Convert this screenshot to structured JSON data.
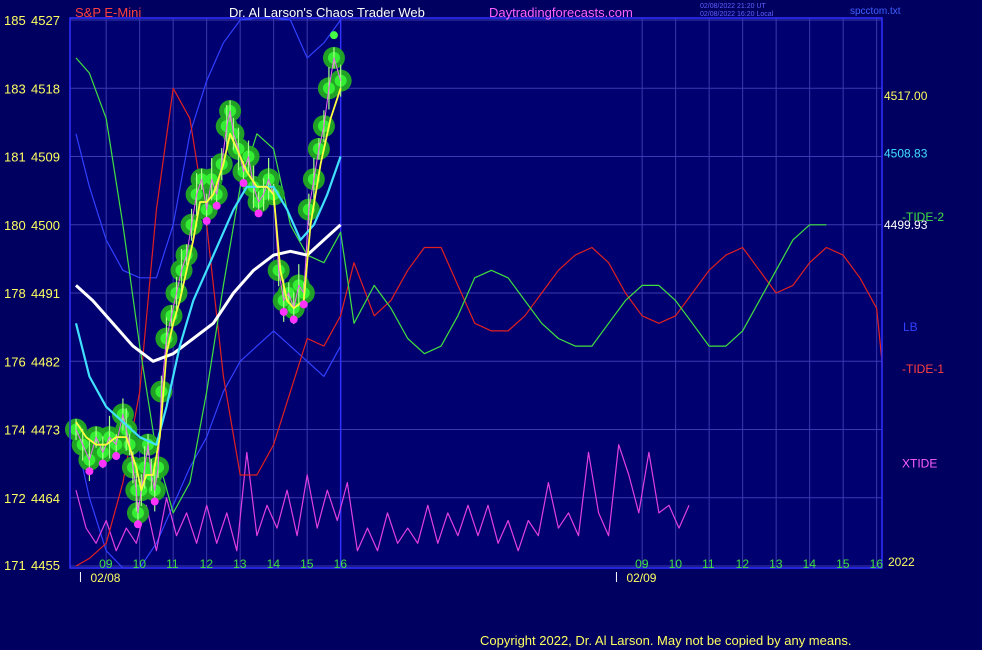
{
  "header": {
    "symbol": "S&P E-Mini",
    "title": "Dr. Al Larson's Chaos Trader Web",
    "site": "Daytradingforecasts.com",
    "stamp_line1": "02/08/2022 21:20 UT",
    "stamp_line2": "02/08/2022 16:20 Local",
    "file": "spcctom.txt"
  },
  "footer": {
    "year": "2022",
    "copyright": "Copyright 2022, Dr. Al Larson. May not be copied by any means."
  },
  "colors": {
    "background": "#000060",
    "plot_bg": "#000070",
    "grid": "#3a3ab0",
    "frame": "#3030ff",
    "price_green": "#22dd22",
    "tide1": "#e02020",
    "tide2": "#40e040",
    "xtide": "#e040e0",
    "lb": "#3040ff",
    "ma_yellow": "#ffff40",
    "ma_cyan": "#40e0ff",
    "ma_white": "#ffffff",
    "label_yellow": "#ffff60",
    "label_cyan": "#40e0ff",
    "label_red": "#ff4040",
    "label_magenta": "#ff60ff"
  },
  "chart_data": {
    "type": "line",
    "x_unit": "session hour (02/08 09:00 = 9, 02/09 09:00 = 25)",
    "xlim": [
      8.1,
      32.1
    ],
    "ylim": [
      4455,
      4527
    ],
    "y_ticks": [
      {
        "left": "185",
        "value": "4527"
      },
      {
        "left": "183",
        "value": "4518"
      },
      {
        "left": "181",
        "value": "4509"
      },
      {
        "left": "180",
        "value": "4500"
      },
      {
        "left": "178",
        "value": "4491"
      },
      {
        "left": "176",
        "value": "4482"
      },
      {
        "left": "174",
        "value": "4473"
      },
      {
        "left": "172",
        "value": "4464"
      },
      {
        "left": "171",
        "value": "4455"
      }
    ],
    "x_ticks": [
      {
        "x": 9,
        "label": "09"
      },
      {
        "x": 10,
        "label": "10"
      },
      {
        "x": 11,
        "label": "11"
      },
      {
        "x": 12,
        "label": "12"
      },
      {
        "x": 13,
        "label": "13"
      },
      {
        "x": 14,
        "label": "14"
      },
      {
        "x": 15,
        "label": "15"
      },
      {
        "x": 16,
        "label": "16"
      },
      {
        "x": 25,
        "label": "09"
      },
      {
        "x": 26,
        "label": "10"
      },
      {
        "x": 27,
        "label": "11"
      },
      {
        "x": 28,
        "label": "12"
      },
      {
        "x": 29,
        "label": "13"
      },
      {
        "x": 30,
        "label": "14"
      },
      {
        "x": 31,
        "label": "15"
      },
      {
        "x": 32,
        "label": "16"
      }
    ],
    "date_labels": [
      {
        "x": 8.8,
        "label": "02/08"
      },
      {
        "x": 24.8,
        "label": "02/09"
      }
    ],
    "price_points": [
      [
        8.1,
        4473
      ],
      [
        8.3,
        4471
      ],
      [
        8.5,
        4469
      ],
      [
        8.7,
        4472
      ],
      [
        8.9,
        4470
      ],
      [
        9.1,
        4472
      ],
      [
        9.3,
        4471
      ],
      [
        9.5,
        4475
      ],
      [
        9.6,
        4473
      ],
      [
        9.7,
        4471
      ],
      [
        9.8,
        4468
      ],
      [
        9.9,
        4465
      ],
      [
        9.95,
        4462
      ],
      [
        10.05,
        4465
      ],
      [
        10.15,
        4468
      ],
      [
        10.25,
        4471
      ],
      [
        10.35,
        4467
      ],
      [
        10.45,
        4465
      ],
      [
        10.55,
        4468
      ],
      [
        10.65,
        4478
      ],
      [
        10.8,
        4485
      ],
      [
        10.95,
        4488
      ],
      [
        11.1,
        4491
      ],
      [
        11.25,
        4494
      ],
      [
        11.4,
        4496
      ],
      [
        11.55,
        4500
      ],
      [
        11.7,
        4504
      ],
      [
        11.85,
        4506
      ],
      [
        12.0,
        4502
      ],
      [
        12.15,
        4506
      ],
      [
        12.3,
        4504
      ],
      [
        12.45,
        4508
      ],
      [
        12.6,
        4513
      ],
      [
        12.7,
        4515
      ],
      [
        12.8,
        4512
      ],
      [
        12.95,
        4510
      ],
      [
        13.1,
        4507
      ],
      [
        13.25,
        4509
      ],
      [
        13.4,
        4505
      ],
      [
        13.55,
        4503
      ],
      [
        13.7,
        4504
      ],
      [
        13.85,
        4506
      ],
      [
        14.0,
        4504
      ],
      [
        14.15,
        4494
      ],
      [
        14.3,
        4490
      ],
      [
        14.45,
        4491
      ],
      [
        14.6,
        4489
      ],
      [
        14.75,
        4492
      ],
      [
        14.9,
        4491
      ],
      [
        15.05,
        4502
      ],
      [
        15.2,
        4506
      ],
      [
        15.35,
        4510
      ],
      [
        15.5,
        4513
      ],
      [
        15.65,
        4518
      ],
      [
        15.8,
        4522
      ],
      [
        16.0,
        4519
      ]
    ],
    "ma_yellow": [
      [
        8.1,
        4474
      ],
      [
        8.4,
        4472
      ],
      [
        8.7,
        4471
      ],
      [
        9.0,
        4471
      ],
      [
        9.3,
        4472
      ],
      [
        9.6,
        4472
      ],
      [
        9.9,
        4468
      ],
      [
        10.05,
        4465
      ],
      [
        10.2,
        4467
      ],
      [
        10.4,
        4467
      ],
      [
        10.6,
        4472
      ],
      [
        10.8,
        4483
      ],
      [
        11.0,
        4487
      ],
      [
        11.2,
        4490
      ],
      [
        11.4,
        4494
      ],
      [
        11.6,
        4498
      ],
      [
        11.8,
        4503
      ],
      [
        12.0,
        4503
      ],
      [
        12.2,
        4504
      ],
      [
        12.5,
        4508
      ],
      [
        12.7,
        4512
      ],
      [
        12.9,
        4510
      ],
      [
        13.2,
        4507
      ],
      [
        13.5,
        4505
      ],
      [
        13.8,
        4505
      ],
      [
        14.0,
        4504
      ],
      [
        14.2,
        4494
      ],
      [
        14.4,
        4490
      ],
      [
        14.6,
        4489
      ],
      [
        14.9,
        4490
      ],
      [
        15.1,
        4500
      ],
      [
        15.4,
        4508
      ],
      [
        15.7,
        4514
      ],
      [
        16.0,
        4518
      ]
    ],
    "ma_cyan": [
      [
        8.1,
        4487
      ],
      [
        8.5,
        4480
      ],
      [
        9.0,
        4476
      ],
      [
        9.5,
        4474
      ],
      [
        10.0,
        4472
      ],
      [
        10.5,
        4471
      ],
      [
        10.8,
        4476
      ],
      [
        11.2,
        4484
      ],
      [
        11.6,
        4490
      ],
      [
        12.0,
        4494
      ],
      [
        12.4,
        4498
      ],
      [
        12.8,
        4502
      ],
      [
        13.2,
        4505
      ],
      [
        13.6,
        4505
      ],
      [
        14.0,
        4505
      ],
      [
        14.4,
        4502
      ],
      [
        14.8,
        4498
      ],
      [
        15.2,
        4500
      ],
      [
        15.6,
        4504
      ],
      [
        16.0,
        4509
      ]
    ],
    "ma_white": [
      [
        8.1,
        4492
      ],
      [
        8.6,
        4490
      ],
      [
        9.2,
        4487
      ],
      [
        9.8,
        4484
      ],
      [
        10.4,
        4482
      ],
      [
        11.0,
        4483
      ],
      [
        11.6,
        4485
      ],
      [
        12.2,
        4487
      ],
      [
        12.8,
        4491
      ],
      [
        13.4,
        4494
      ],
      [
        14.0,
        4496
      ],
      [
        14.5,
        4496.5
      ],
      [
        15.0,
        4496
      ],
      [
        15.5,
        4498
      ],
      [
        16.0,
        4500
      ]
    ],
    "lb_upper": [
      [
        8.1,
        4512
      ],
      [
        8.5,
        4505
      ],
      [
        9.0,
        4498
      ],
      [
        9.5,
        4494
      ],
      [
        10.0,
        4493
      ],
      [
        10.5,
        4493
      ],
      [
        11.0,
        4500
      ],
      [
        11.5,
        4512
      ],
      [
        12.0,
        4519
      ],
      [
        12.5,
        4524
      ],
      [
        13.0,
        4527
      ],
      [
        13.5,
        4528
      ],
      [
        14.0,
        4530
      ],
      [
        14.5,
        4527
      ],
      [
        15.0,
        4522
      ],
      [
        15.5,
        4524
      ],
      [
        16.0,
        4527
      ]
    ],
    "lb_lower": [
      [
        8.1,
        4472
      ],
      [
        8.5,
        4464
      ],
      [
        9.0,
        4457
      ],
      [
        9.5,
        4454
      ],
      [
        10.0,
        4454
      ],
      [
        10.5,
        4458
      ],
      [
        11.0,
        4463
      ],
      [
        11.5,
        4468
      ],
      [
        12.0,
        4472
      ],
      [
        12.5,
        4478
      ],
      [
        13.0,
        4482
      ],
      [
        13.5,
        4484
      ],
      [
        14.0,
        4486
      ],
      [
        14.5,
        4484
      ],
      [
        15.0,
        4482
      ],
      [
        15.5,
        4480
      ],
      [
        16.0,
        4484
      ]
    ],
    "tide1": [
      [
        8.1,
        4455
      ],
      [
        8.5,
        4456
      ],
      [
        9.0,
        4458
      ],
      [
        9.5,
        4466
      ],
      [
        10.0,
        4478
      ],
      [
        10.5,
        4502
      ],
      [
        11.0,
        4518
      ],
      [
        11.5,
        4514
      ],
      [
        12.0,
        4500
      ],
      [
        12.5,
        4480
      ],
      [
        13.0,
        4467
      ],
      [
        13.5,
        4467
      ],
      [
        14.0,
        4471
      ],
      [
        14.5,
        4478
      ],
      [
        15.0,
        4485
      ],
      [
        15.5,
        4484
      ],
      [
        16.0,
        4488
      ],
      [
        16.4,
        4495
      ],
      [
        17.0,
        4488
      ],
      [
        17.5,
        4490
      ],
      [
        18.0,
        4494
      ],
      [
        18.5,
        4497
      ],
      [
        19.0,
        4497
      ],
      [
        19.5,
        4492
      ],
      [
        20.0,
        4487
      ],
      [
        20.5,
        4486
      ],
      [
        21.0,
        4486
      ],
      [
        21.5,
        4488
      ],
      [
        22.0,
        4491
      ],
      [
        22.5,
        4494
      ],
      [
        23.0,
        4496
      ],
      [
        23.5,
        4497
      ],
      [
        24.0,
        4495
      ],
      [
        24.5,
        4491
      ],
      [
        25.0,
        4488
      ],
      [
        25.5,
        4487
      ],
      [
        26.0,
        4488
      ],
      [
        26.5,
        4491
      ],
      [
        27.0,
        4494
      ],
      [
        27.5,
        4496
      ],
      [
        28.0,
        4497
      ],
      [
        28.5,
        4494
      ],
      [
        29.0,
        4491
      ],
      [
        29.5,
        4492
      ],
      [
        30.0,
        4495
      ],
      [
        30.5,
        4497
      ],
      [
        31.0,
        4496
      ],
      [
        31.5,
        4493
      ],
      [
        32.0,
        4489
      ],
      [
        32.5,
        4482
      ],
      [
        33.0,
        4481
      ]
    ],
    "tide2": [
      [
        8.1,
        4522
      ],
      [
        8.5,
        4520
      ],
      [
        9.0,
        4514
      ],
      [
        9.5,
        4500
      ],
      [
        10.0,
        4484
      ],
      [
        10.5,
        4470
      ],
      [
        11.0,
        4462
      ],
      [
        11.5,
        4466
      ],
      [
        12.0,
        4478
      ],
      [
        12.5,
        4492
      ],
      [
        13.0,
        4505
      ],
      [
        13.5,
        4512
      ],
      [
        14.0,
        4510
      ],
      [
        14.5,
        4500
      ],
      [
        15.0,
        4496
      ],
      [
        15.5,
        4495
      ],
      [
        16.0,
        4499
      ],
      [
        16.4,
        4487
      ],
      [
        17.0,
        4492
      ],
      [
        17.5,
        4489
      ],
      [
        18.0,
        4485
      ],
      [
        18.5,
        4483
      ],
      [
        19.0,
        4484
      ],
      [
        19.5,
        4488
      ],
      [
        20.0,
        4493
      ],
      [
        20.5,
        4494
      ],
      [
        21.0,
        4493
      ],
      [
        21.5,
        4490
      ],
      [
        22.0,
        4487
      ],
      [
        22.5,
        4485
      ],
      [
        23.0,
        4484
      ],
      [
        23.5,
        4484
      ],
      [
        24.0,
        4487
      ],
      [
        24.5,
        4490
      ],
      [
        25.0,
        4492
      ],
      [
        25.5,
        4492
      ],
      [
        26.0,
        4490
      ],
      [
        26.5,
        4487
      ],
      [
        27.0,
        4484
      ],
      [
        27.5,
        4484
      ],
      [
        28.0,
        4486
      ],
      [
        28.5,
        4490
      ],
      [
        29.0,
        4494
      ],
      [
        29.5,
        4498
      ],
      [
        30.0,
        4500
      ],
      [
        30.5,
        4500
      ]
    ],
    "xtide": [
      [
        8.1,
        4465
      ],
      [
        8.4,
        4460
      ],
      [
        8.7,
        4458
      ],
      [
        9.0,
        4461
      ],
      [
        9.3,
        4457
      ],
      [
        9.6,
        4460
      ],
      [
        9.9,
        4458
      ],
      [
        10.2,
        4463
      ],
      [
        10.5,
        4457
      ],
      [
        10.8,
        4464
      ],
      [
        11.1,
        4459
      ],
      [
        11.4,
        4462
      ],
      [
        11.7,
        4458
      ],
      [
        12.0,
        4463
      ],
      [
        12.3,
        4458
      ],
      [
        12.6,
        4462
      ],
      [
        12.9,
        4457
      ],
      [
        13.2,
        4470
      ],
      [
        13.5,
        4459
      ],
      [
        13.8,
        4463
      ],
      [
        14.1,
        4460
      ],
      [
        14.4,
        4465
      ],
      [
        14.7,
        4459
      ],
      [
        15.0,
        4467
      ],
      [
        15.3,
        4460
      ],
      [
        15.6,
        4465
      ],
      [
        15.9,
        4461
      ],
      [
        16.2,
        4466
      ],
      [
        16.5,
        4457
      ],
      [
        16.8,
        4460
      ],
      [
        17.1,
        4457
      ],
      [
        17.4,
        4462
      ],
      [
        17.7,
        4458
      ],
      [
        18.0,
        4460
      ],
      [
        18.3,
        4458
      ],
      [
        18.6,
        4463
      ],
      [
        18.9,
        4458
      ],
      [
        19.2,
        4462
      ],
      [
        19.5,
        4459
      ],
      [
        19.8,
        4463
      ],
      [
        20.1,
        4459
      ],
      [
        20.4,
        4463
      ],
      [
        20.7,
        4458
      ],
      [
        21.0,
        4461
      ],
      [
        21.3,
        4457
      ],
      [
        21.6,
        4461
      ],
      [
        21.9,
        4459
      ],
      [
        22.2,
        4466
      ],
      [
        22.5,
        4460
      ],
      [
        22.8,
        4462
      ],
      [
        23.1,
        4459
      ],
      [
        23.4,
        4470
      ],
      [
        23.7,
        4462
      ],
      [
        24.0,
        4459
      ],
      [
        24.3,
        4471
      ],
      [
        24.6,
        4467
      ],
      [
        24.9,
        4462
      ],
      [
        25.2,
        4470
      ],
      [
        25.5,
        4462
      ],
      [
        25.8,
        4463
      ],
      [
        26.1,
        4460
      ],
      [
        26.4,
        4463
      ]
    ],
    "current_price": 4517.0,
    "price_labels": [
      {
        "text": "4517.00",
        "value": 4517.0,
        "color": "yellow"
      },
      {
        "text": "4508.83",
        "value": 4509.4,
        "color": "cyan"
      },
      {
        "text": "4499.93",
        "value": 4500.0,
        "color": "white"
      }
    ],
    "series_labels": [
      {
        "text": "-TIDE-2",
        "value": 4501,
        "color": "green"
      },
      {
        "text": "LB",
        "value": 4486.5,
        "color": "blue"
      },
      {
        "text": "-TIDE-1",
        "value": 4481,
        "color": "red"
      },
      {
        "text": "XTIDE",
        "value": 4468.5,
        "color": "magenta"
      }
    ]
  }
}
